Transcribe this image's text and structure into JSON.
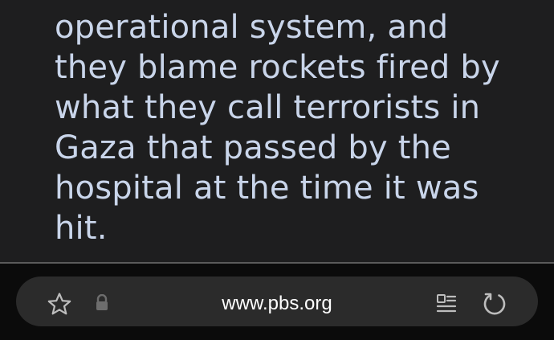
{
  "article": {
    "lines": [
      "operational system, and",
      "they blame rockets fired by",
      "what they call terrorists in",
      "Gaza that passed by the",
      "hospital at the time it was",
      "hit."
    ]
  },
  "browser": {
    "url": "www.pbs.org",
    "icons": {
      "bookmark": "star-icon",
      "security": "lock-icon",
      "reader": "reader-view-icon",
      "reload": "reload-icon"
    }
  },
  "colors": {
    "page_background": "#1e1e1f",
    "article_text": "#c9d5ea",
    "toolbar_background": "#0b0b0b",
    "address_bar_background": "#2b2b2b",
    "icon_color": "#bdbdbd",
    "url_text": "#ffffff"
  }
}
